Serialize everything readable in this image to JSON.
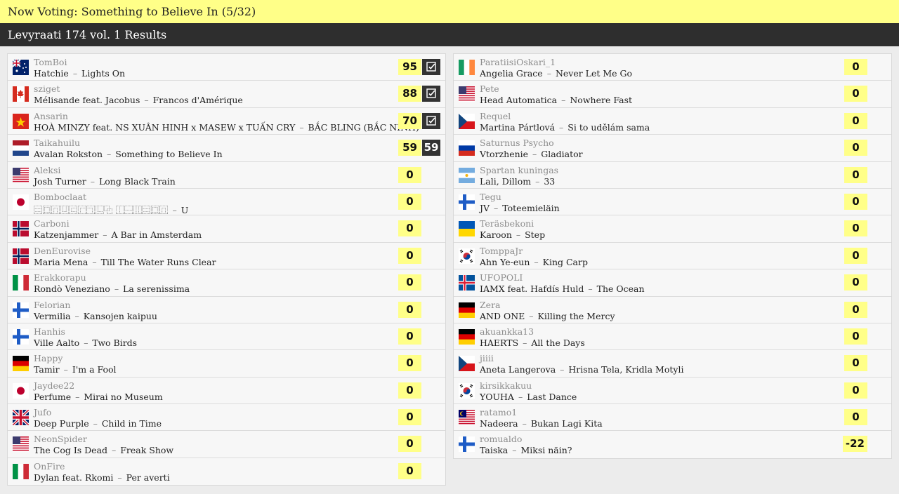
{
  "now_voting": "Now Voting: Something to Believe In (5/32)",
  "results_title": "Levyraati 174 vol. 1 Results",
  "left": [
    {
      "user": "TomBoi",
      "artist": "Hatchie",
      "title": "Lights On",
      "score": "95",
      "vote": "check",
      "flag": "au"
    },
    {
      "user": "sziget",
      "artist": "Mélisande feat. Jacobus",
      "title": "Francos d'Amérique",
      "score": "88",
      "vote": "check",
      "flag": "ca"
    },
    {
      "user": "Ansarin",
      "artist": "HOÀ MINZY feat. NS XUÂN HINH x MASEW x TUẤN CRY",
      "title": "BẮC BLING (BẮC NINH)",
      "score": "70",
      "vote": "check",
      "flag": "vn"
    },
    {
      "user": "Taikahuilu",
      "artist": "Avalan Rokston",
      "title": "Something to Believe In",
      "score": "59",
      "vote": "59",
      "flag": "nl"
    },
    {
      "user": "Aleksi",
      "artist": "Josh Turner",
      "title": "Long Black Train",
      "score": "0",
      "vote": "",
      "flag": "us"
    },
    {
      "user": "Bomboclaat",
      "artist": "⿳⿴⿵⿶⿷⿸⿹⿺⿻ ⿰⿱⿲⿳⿴⿵",
      "title": "U",
      "score": "0",
      "vote": "",
      "flag": "jp"
    },
    {
      "user": "Carboni",
      "artist": "Katzenjammer",
      "title": "A Bar in Amsterdam",
      "score": "0",
      "vote": "",
      "flag": "no"
    },
    {
      "user": "DenEurovise",
      "artist": "Maria Mena",
      "title": "Till The Water Runs Clear",
      "score": "0",
      "vote": "",
      "flag": "no"
    },
    {
      "user": "Erakkorapu",
      "artist": "Rondò Veneziano",
      "title": "La serenissima",
      "score": "0",
      "vote": "",
      "flag": "it"
    },
    {
      "user": "Felorian",
      "artist": "Vermilia",
      "title": "Kansojen kaipuu",
      "score": "0",
      "vote": "",
      "flag": "fi"
    },
    {
      "user": "Hanhis",
      "artist": "Ville Aalto",
      "title": "Two Birds",
      "score": "0",
      "vote": "",
      "flag": "fi"
    },
    {
      "user": "Happy",
      "artist": "Tamir",
      "title": "I'm a Fool",
      "score": "0",
      "vote": "",
      "flag": "de"
    },
    {
      "user": "Jaydee22",
      "artist": "Perfume",
      "title": "Mirai no Museum",
      "score": "0",
      "vote": "",
      "flag": "jp"
    },
    {
      "user": "Jufo",
      "artist": "Deep Purple",
      "title": "Child in Time",
      "score": "0",
      "vote": "",
      "flag": "gb"
    },
    {
      "user": "NeonSpider",
      "artist": "The Cog Is Dead",
      "title": "Freak Show",
      "score": "0",
      "vote": "",
      "flag": "us"
    },
    {
      "user": "OnFire",
      "artist": "Dylan feat. Rkomi",
      "title": "Per averti",
      "score": "0",
      "vote": "",
      "flag": "it"
    }
  ],
  "right": [
    {
      "user": "ParatiisiOskari_1",
      "artist": "Angelia Grace",
      "title": "Never Let Me Go",
      "score": "0",
      "vote": "",
      "flag": "ie"
    },
    {
      "user": "Pete",
      "artist": "Head Automatica",
      "title": "Nowhere Fast",
      "score": "0",
      "vote": "",
      "flag": "us"
    },
    {
      "user": "Requel",
      "artist": "Martina Pártlová",
      "title": "Si to udělám sama",
      "score": "0",
      "vote": "",
      "flag": "cz"
    },
    {
      "user": "Saturnus Psycho",
      "artist": "Vtorzhenie",
      "title": "Gladiator",
      "score": "0",
      "vote": "",
      "flag": "ru"
    },
    {
      "user": "Spartan kuningas",
      "artist": "Lali, Dillom",
      "title": "33",
      "score": "0",
      "vote": "",
      "flag": "ar"
    },
    {
      "user": "Tegu",
      "artist": "JV",
      "title": "Toteemieläin",
      "score": "0",
      "vote": "",
      "flag": "fi"
    },
    {
      "user": "Teräsbekoni",
      "artist": "Karoon",
      "title": "Step",
      "score": "0",
      "vote": "",
      "flag": "ua"
    },
    {
      "user": "TomppaJr",
      "artist": "Ahn Ye-eun",
      "title": "King Carp",
      "score": "0",
      "vote": "",
      "flag": "kr"
    },
    {
      "user": "UFOPOLI",
      "artist": "IAMX feat. Hafdís Huld",
      "title": "The Ocean",
      "score": "0",
      "vote": "",
      "flag": "is"
    },
    {
      "user": "Zera",
      "artist": "AND ONE",
      "title": "Killing the Mercy",
      "score": "0",
      "vote": "",
      "flag": "de"
    },
    {
      "user": "akuankka13",
      "artist": "HAERTS",
      "title": "All the Days",
      "score": "0",
      "vote": "",
      "flag": "de"
    },
    {
      "user": "jiiii",
      "artist": "Aneta Langerova",
      "title": "Hrisna Tela, Kridla Motyli",
      "score": "0",
      "vote": "",
      "flag": "cz"
    },
    {
      "user": "kirsikkakuu",
      "artist": "YOUHA",
      "title": "Last Dance",
      "score": "0",
      "vote": "",
      "flag": "kr"
    },
    {
      "user": "ratamo1",
      "artist": "Nadeera",
      "title": "Bukan Lagi Kita",
      "score": "0",
      "vote": "",
      "flag": "my"
    },
    {
      "user": "romualdo",
      "artist": "Taiska",
      "title": "Miksi näin?",
      "score": "-22",
      "vote": "",
      "flag": "fi"
    }
  ],
  "separator": "–",
  "colors": {
    "accent_yellow": "#ffff88",
    "header_dark": "#2e2e2e"
  }
}
